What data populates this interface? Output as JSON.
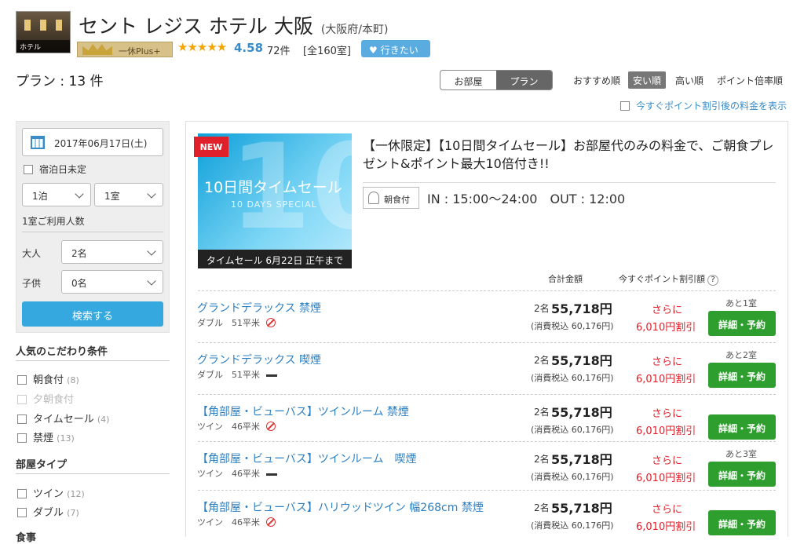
{
  "header": {
    "thumb_caption": "ホテル",
    "hotel_name": "セント レジス ホテル 大阪",
    "location": "(大阪府/本町)",
    "badge": "一休Plus+",
    "stars": "★★★★★",
    "rating": "4.58",
    "review_count": "72件",
    "room_total": "[全160室]",
    "want_button": "行きたい"
  },
  "toolbar": {
    "plan_count": "プラン : 13 件",
    "tab_rooms": "お部屋",
    "tab_plans": "プラン",
    "sort_recommended": "おすすめ順",
    "sort_cheap": "安い順",
    "sort_expensive": "高い順",
    "sort_points": "ポイント倍率順",
    "point_toggle": "今すぐポイント割引後の料金を表示"
  },
  "sidebar": {
    "date": "2017年06月17日(土)",
    "undecided": "宿泊日未定",
    "nights": "1泊",
    "rooms": "1室",
    "guests_label": "1室ご利用人数",
    "adult_label": "大人",
    "adult_value": "2名",
    "child_label": "子供",
    "child_value": "0名",
    "search_button": "検索する",
    "popular_heading": "人気のこだわり条件",
    "popular": [
      {
        "label": "朝食付",
        "count": "(8)"
      },
      {
        "label": "夕朝食付",
        "count": ""
      },
      {
        "label": "タイムセール",
        "count": "(4)"
      },
      {
        "label": "禁煙",
        "count": "(13)"
      }
    ],
    "roomtype_heading": "部屋タイプ",
    "roomtypes": [
      {
        "label": "ツイン",
        "count": "(12)"
      },
      {
        "label": "ダブル",
        "count": "(7)"
      }
    ],
    "meal_heading": "食事"
  },
  "plan": {
    "new_tag": "NEW",
    "banner_big": "10",
    "banner_title": "10日間タイムセール",
    "banner_sub": "10 DAYS SPECIAL",
    "banner_footer": "タイムセール 6月22日 正午まで",
    "title": "【一休限定】【10日間タイムセール】お部屋代のみの料金で、ご朝食プレゼント&ポイント最大10倍付き!!",
    "meal_tag": "朝食付",
    "checkin_out": "IN : 15:00〜24:00　OUT : 12:00",
    "col_total": "合計金額",
    "col_point": "今すぐポイント割引額",
    "help": "?"
  },
  "rooms": [
    {
      "name": "グランドデラックス 禁煙",
      "bed": "ダブル",
      "size": "51平米",
      "smoking": false,
      "people": "2名",
      "price": "55,718円",
      "tax": "(消費税込 60,176円)",
      "further": "さらに",
      "discount": "6,010円割引",
      "left": "あと1室",
      "book": "詳細・予約"
    },
    {
      "name": "グランドデラックス 喫煙",
      "bed": "ダブル",
      "size": "51平米",
      "smoking": true,
      "people": "2名",
      "price": "55,718円",
      "tax": "(消費税込 60,176円)",
      "further": "さらに",
      "discount": "6,010円割引",
      "left": "あと2室",
      "book": "詳細・予約"
    },
    {
      "name": "【角部屋・ビューバス】ツインルーム 禁煙",
      "bed": "ツイン",
      "size": "46平米",
      "smoking": false,
      "people": "2名",
      "price": "55,718円",
      "tax": "(消費税込 60,176円)",
      "further": "さらに",
      "discount": "6,010円割引",
      "left": "",
      "book": "詳細・予約"
    },
    {
      "name": "【角部屋・ビューバス】ツインルーム　喫煙",
      "bed": "ツイン",
      "size": "46平米",
      "smoking": true,
      "people": "2名",
      "price": "55,718円",
      "tax": "(消費税込 60,176円)",
      "further": "さらに",
      "discount": "6,010円割引",
      "left": "あと3室",
      "book": "詳細・予約"
    },
    {
      "name": "【角部屋・ビューバス】ハリウッドツイン 幅268cm 禁煙",
      "bed": "ツイン",
      "size": "46平米",
      "smoking": false,
      "people": "2名",
      "price": "55,718円",
      "tax": "(消費税込 60,176円)",
      "further": "さらに",
      "discount": "6,010円割引",
      "left": "",
      "book": "詳細・予約"
    }
  ]
}
